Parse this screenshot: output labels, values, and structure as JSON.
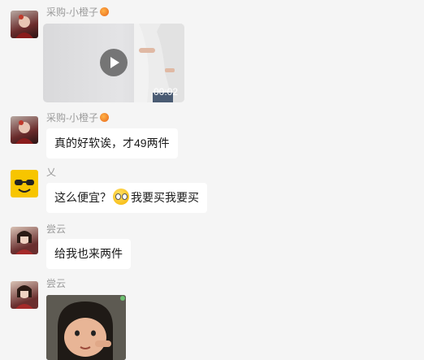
{
  "messages": [
    {
      "sender": "采购-小橙子",
      "type": "video",
      "duration": "00:02"
    },
    {
      "sender": "采购-小橙子",
      "type": "text",
      "text": "真的好软诶，才49两件"
    },
    {
      "sender": "乂",
      "type": "text",
      "text_before": "这么便宜？",
      "emoji": "crying-face-emoji",
      "text_after": "我要买我要买"
    },
    {
      "sender": "尝云",
      "type": "text",
      "text": "给我也来两件"
    },
    {
      "sender": "尝云",
      "type": "image"
    }
  ],
  "colors": {
    "background": "#f5f5f5",
    "bubble": "#ffffff",
    "name_text": "#9b9b9b"
  }
}
